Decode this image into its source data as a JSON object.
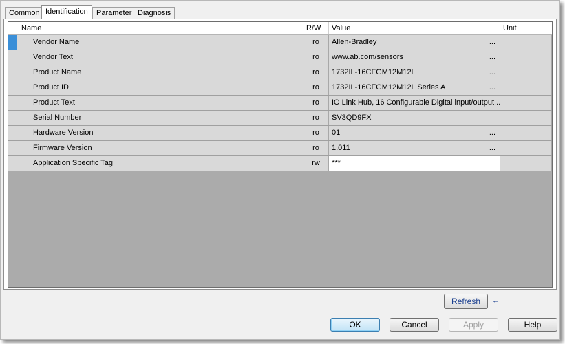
{
  "tabs": [
    {
      "label": "Common"
    },
    {
      "label": "Identification",
      "active": true
    },
    {
      "label": "Parameter"
    },
    {
      "label": "Diagnosis"
    }
  ],
  "grid": {
    "columns": {
      "name": "Name",
      "rw": "R/W",
      "value": "Value",
      "unit": "Unit"
    },
    "rows": [
      {
        "name": "Vendor Name",
        "rw": "ro",
        "value": "Allen-Bradley",
        "browse": "...",
        "unit": ""
      },
      {
        "name": "Vendor Text",
        "rw": "ro",
        "value": "www.ab.com/sensors",
        "browse": "...",
        "unit": ""
      },
      {
        "name": "Product Name",
        "rw": "ro",
        "value": "1732IL-16CFGM12M12L",
        "browse": "...",
        "unit": ""
      },
      {
        "name": "Product ID",
        "rw": "ro",
        "value": "1732IL-16CFGM12M12L Series A",
        "browse": "...",
        "unit": ""
      },
      {
        "name": "Product Text",
        "rw": "ro",
        "value": "IO Link Hub, 16 Configurable Digital input/output...",
        "browse": "",
        "unit": ""
      },
      {
        "name": "Serial Number",
        "rw": "ro",
        "value": "SV3QD9FX",
        "browse": "",
        "unit": ""
      },
      {
        "name": "Hardware Version",
        "rw": "ro",
        "value": "01",
        "browse": "...",
        "unit": ""
      },
      {
        "name": "Firmware Version",
        "rw": "ro",
        "value": "1.011",
        "browse": "...",
        "unit": ""
      },
      {
        "name": "Application Specific Tag",
        "rw": "rw",
        "value": "***",
        "browse": "",
        "unit": ""
      }
    ]
  },
  "buttons": {
    "refresh": "Refresh",
    "ok": "OK",
    "cancel": "Cancel",
    "apply": "Apply",
    "help": "Help"
  },
  "icons": {
    "refresh_pointer": "arrow-left-icon"
  },
  "colors": {
    "selection": "#3a8fd8",
    "grid_background": "#ababab",
    "row_background": "#d9d9d9"
  }
}
